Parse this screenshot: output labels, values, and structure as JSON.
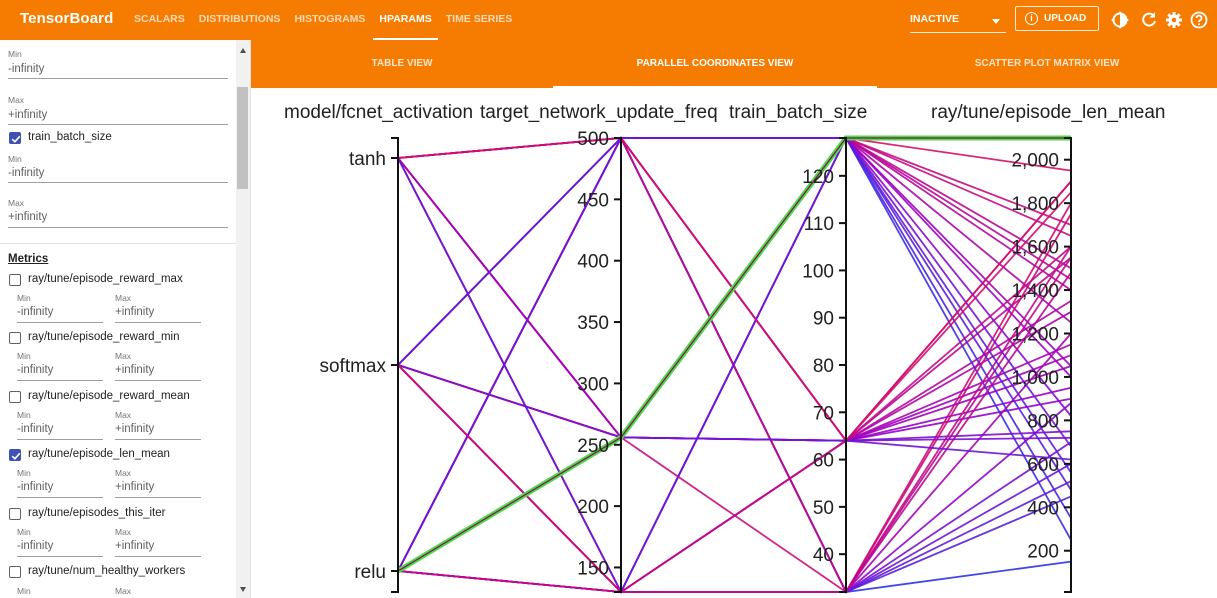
{
  "app": {
    "title": "TensorBoard",
    "nav_tabs": [
      "SCALARS",
      "DISTRIBUTIONS",
      "HISTOGRAMS",
      "HPARAMS",
      "TIME SERIES"
    ],
    "active_tab": "HPARAMS",
    "run_selector": "INACTIVE",
    "upload_label": "UPLOAD",
    "icons": [
      "theme-icon",
      "refresh-icon",
      "settings-icon",
      "help-icon"
    ]
  },
  "sidebar": {
    "top_fields": [
      {
        "label": "Min",
        "value": "-infinity"
      },
      {
        "label": "Max",
        "value": "+infinity"
      }
    ],
    "hparam_item": {
      "label": "train_batch_size",
      "checked": true,
      "min_label": "Min",
      "min_value": "-infinity",
      "max_label": "Max",
      "max_value": "+infinity"
    },
    "metrics_heading": "Metrics",
    "metrics": [
      {
        "label": "ray/tune/episode_reward_max",
        "checked": false,
        "min_label": "Min",
        "min_value": "-infinity",
        "max_label": "Max",
        "max_value": "+infinity"
      },
      {
        "label": "ray/tune/episode_reward_min",
        "checked": false,
        "min_label": "Min",
        "min_value": "-infinity",
        "max_label": "Max",
        "max_value": "+infinity"
      },
      {
        "label": "ray/tune/episode_reward_mean",
        "checked": false,
        "min_label": "Min",
        "min_value": "-infinity",
        "max_label": "Max",
        "max_value": "+infinity"
      },
      {
        "label": "ray/tune/episode_len_mean",
        "checked": true,
        "min_label": "Min",
        "min_value": "-infinity",
        "max_label": "Max",
        "max_value": "+infinity"
      },
      {
        "label": "ray/tune/episodes_this_iter",
        "checked": false,
        "min_label": "Min",
        "min_value": "-infinity",
        "max_label": "Max",
        "max_value": "+infinity"
      },
      {
        "label": "ray/tune/num_healthy_workers",
        "checked": false,
        "min_label": "Min",
        "min_value": "",
        "max_label": "Max",
        "max_value": ""
      }
    ]
  },
  "view_tabs": [
    "TABLE VIEW",
    "PARALLEL COORDINATES VIEW",
    "SCATTER PLOT MATRIX VIEW"
  ],
  "active_view": "PARALLEL COORDINATES VIEW",
  "chart_data": {
    "type": "parallel_coordinates",
    "axes": [
      {
        "name": "model/fcnet_activation",
        "type": "categorical",
        "categories": [
          "tanh",
          "softmax",
          "relu"
        ]
      },
      {
        "name": "target_network_update_freq",
        "type": "linear",
        "range": [
          130,
          500
        ],
        "ticks": [
          "500",
          "450",
          "400",
          "350",
          "300",
          "250",
          "200",
          "150"
        ]
      },
      {
        "name": "train_batch_size",
        "type": "linear",
        "range": [
          32,
          128
        ],
        "ticks": [
          "120",
          "110",
          "100",
          "90",
          "80",
          "70",
          "60",
          "50",
          "40"
        ]
      },
      {
        "name": "ray/tune/episode_len_mean",
        "type": "linear",
        "range": [
          10,
          2100
        ],
        "ticks": [
          "2,000",
          "1,800",
          "1,600",
          "1,400",
          "1,200",
          "1,000",
          "800",
          "600",
          "400",
          "200"
        ]
      }
    ],
    "colors": {
      "low": "#1a3cf0",
      "mid": "#9a00c8",
      "high": "#e0105a",
      "selected": "#4cd94c"
    },
    "selected_run": [
      "relu",
      256,
      128,
      2100
    ],
    "runs": [
      [
        "tanh",
        500,
        32,
        150
      ],
      [
        "tanh",
        500,
        32,
        520
      ],
      [
        "tanh",
        500,
        64,
        900
      ],
      [
        "tanh",
        256,
        128,
        1700
      ],
      [
        "tanh",
        256,
        128,
        1950
      ],
      [
        "tanh",
        130,
        64,
        1100
      ],
      [
        "tanh",
        130,
        128,
        1500
      ],
      [
        "tanh",
        500,
        128,
        1250
      ],
      [
        "tanh",
        256,
        64,
        1350
      ],
      [
        "softmax",
        500,
        32,
        1800
      ],
      [
        "softmax",
        500,
        64,
        1900
      ],
      [
        "softmax",
        256,
        128,
        1450
      ],
      [
        "softmax",
        256,
        128,
        1650
      ],
      [
        "softmax",
        130,
        32,
        700
      ],
      [
        "softmax",
        130,
        64,
        950
      ],
      [
        "softmax",
        500,
        128,
        1050
      ],
      [
        "softmax",
        256,
        64,
        1550
      ],
      [
        "softmax",
        130,
        128,
        820
      ],
      [
        "relu",
        500,
        32,
        600
      ],
      [
        "relu",
        500,
        32,
        450
      ],
      [
        "relu",
        500,
        128,
        350
      ],
      [
        "relu",
        500,
        128,
        250
      ],
      [
        "relu",
        130,
        32,
        1200
      ],
      [
        "relu",
        130,
        64,
        750
      ],
      [
        "relu",
        130,
        128,
        1000
      ],
      [
        "relu",
        256,
        64,
        1300
      ],
      [
        "relu",
        256,
        32,
        1750
      ],
      [
        "relu",
        130,
        32,
        880
      ],
      [
        "relu",
        500,
        64,
        1150
      ],
      [
        "relu",
        256,
        128,
        1400
      ],
      [
        "tanh",
        500,
        32,
        1600
      ],
      [
        "softmax",
        130,
        32,
        1550
      ],
      [
        "relu",
        130,
        32,
        1480
      ],
      [
        "tanh",
        256,
        64,
        1050
      ],
      [
        "softmax",
        256,
        64,
        720
      ],
      [
        "relu",
        256,
        64,
        620
      ],
      [
        "tanh",
        130,
        128,
        560
      ],
      [
        "softmax",
        500,
        128,
        480
      ],
      [
        "relu",
        500,
        128,
        680
      ],
      [
        "tanh",
        500,
        64,
        1900
      ],
      [
        "softmax",
        130,
        64,
        1850
      ],
      [
        "relu",
        130,
        64,
        1600
      ]
    ]
  }
}
